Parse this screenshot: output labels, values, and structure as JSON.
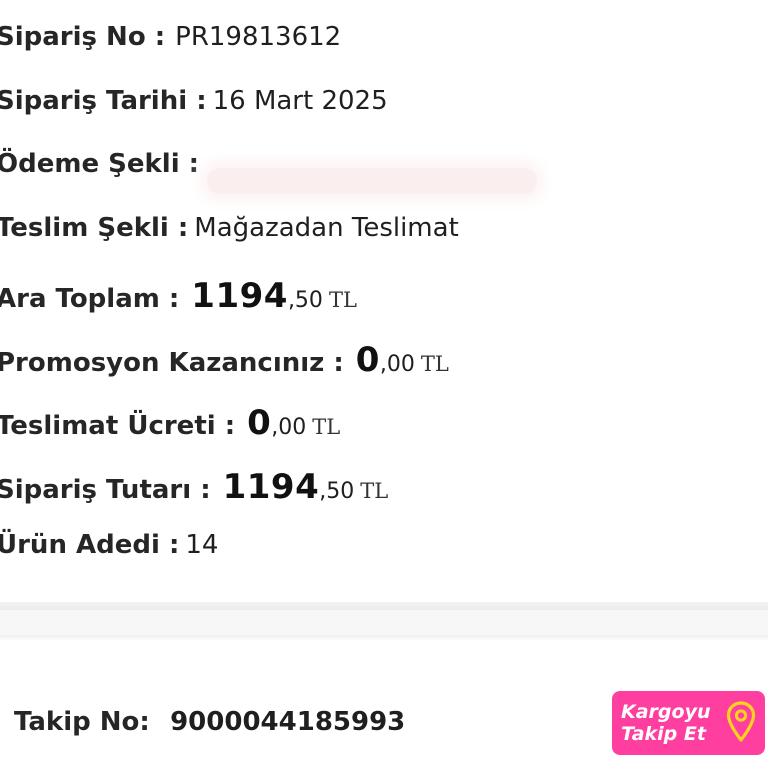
{
  "order": {
    "order_no": {
      "label": "Sipariş No :",
      "value": "PR19813612"
    },
    "order_date": {
      "label": "Sipariş Tarihi :",
      "value": "16 Mart 2025"
    },
    "payment_method": {
      "label": "Ödeme Şekli :",
      "value_redacted": true
    },
    "delivery_method": {
      "label": "Teslim Şekli :",
      "value": "Mağazadan Teslimat"
    },
    "subtotal": {
      "label": "Ara Toplam :",
      "int": "1194",
      "dec": ",50",
      "currency": "TL"
    },
    "promotion": {
      "label": "Promosyon Kazancınız :",
      "int": "0",
      "dec": ",00",
      "currency": "TL"
    },
    "delivery_fee": {
      "label": "Teslimat Ücreti :",
      "int": "0",
      "dec": ",00",
      "currency": "TL"
    },
    "order_total": {
      "label": "Sipariş Tutarı :",
      "int": "1194",
      "dec": ",50",
      "currency": "TL"
    },
    "item_count": {
      "label": "Ürün Adedi :",
      "value": "14"
    }
  },
  "tracking": {
    "label": "Takip No:",
    "number": "9000044185993",
    "button_label": "Kargoyu\nTakip Et",
    "button_icon": "location-pin-icon"
  },
  "colors": {
    "button_bg": "#ff3fa0",
    "pin": "#ffd21f",
    "text": "#262626"
  }
}
